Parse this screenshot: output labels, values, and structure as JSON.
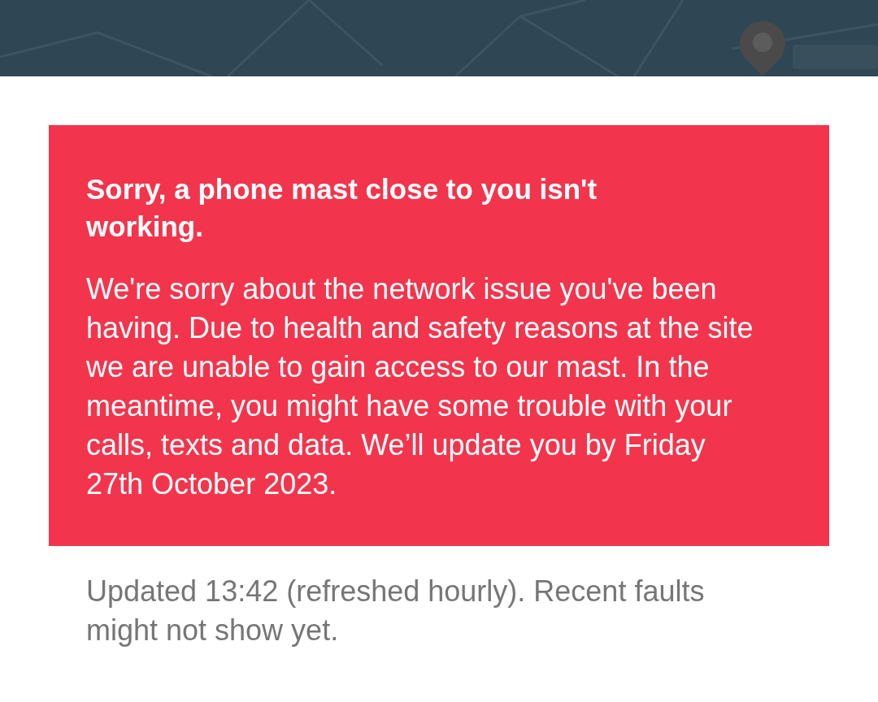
{
  "alert": {
    "title": "Sorry, a phone mast close to you isn't working.",
    "body": "We're sorry about the network issue you've been having. Due to health and safety reasons at the site we are unable to gain access to our mast. In the meantime, you might have some trouble with your calls, texts and data. We’ll update you by Friday 27th October 2023."
  },
  "footer": "Updated 13:42 (refreshed hourly). Recent faults might not show yet."
}
